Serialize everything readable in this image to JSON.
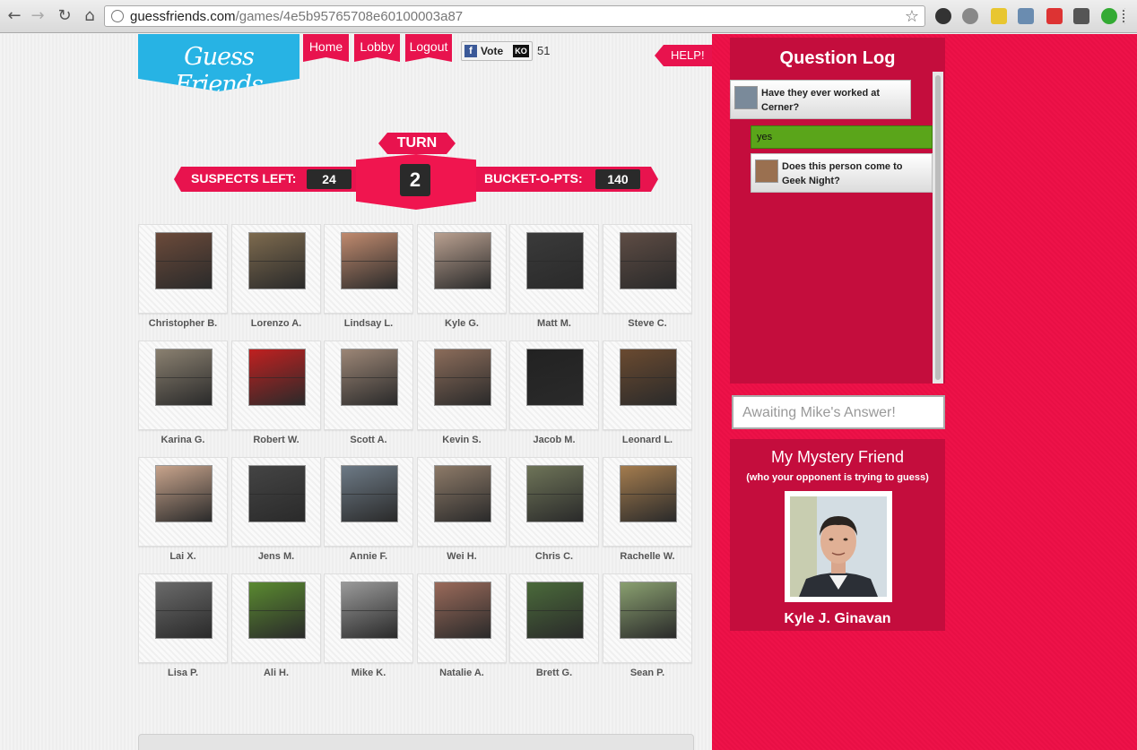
{
  "browser": {
    "url_domain": "guessfriends.com",
    "url_path": "/games/4e5b95765708e60100003a87",
    "back_icon": "back-arrow-icon",
    "forward_icon": "forward-arrow-icon",
    "reload_icon": "reload-icon",
    "home_icon": "home-icon",
    "bookmark_icon": "star-icon"
  },
  "header": {
    "logo_text": "Guess Friends",
    "nav": [
      {
        "label": "Home"
      },
      {
        "label": "Lobby"
      },
      {
        "label": "Logout"
      }
    ],
    "vote_label": "Vote",
    "vote_count": "51",
    "help_label": "HELP!"
  },
  "scoreboard": {
    "turn_label": "TURN",
    "turn_number": "2",
    "suspects_left_label": "SUSPECTS LEFT:",
    "suspects_left_value": "24",
    "bucket_label": "BUCKET-O-PTS:",
    "bucket_value": "140"
  },
  "suspects": [
    {
      "name": "Christopher B.",
      "color": "#6b4a3a"
    },
    {
      "name": "Lorenzo A.",
      "color": "#7d6a4e"
    },
    {
      "name": "Lindsay L.",
      "color": "#c08a6e"
    },
    {
      "name": "Kyle G.",
      "color": "#b9a090"
    },
    {
      "name": "Matt M.",
      "color": "#3a3a3a"
    },
    {
      "name": "Steve C.",
      "color": "#5e4c44"
    },
    {
      "name": "Karina G.",
      "color": "#8a8070"
    },
    {
      "name": "Robert W.",
      "color": "#c02020"
    },
    {
      "name": "Scott A.",
      "color": "#9c8676"
    },
    {
      "name": "Kevin S.",
      "color": "#8b6c5a"
    },
    {
      "name": "Jacob M.",
      "color": "#222222"
    },
    {
      "name": "Leonard L.",
      "color": "#6a4a30"
    },
    {
      "name": "Lai X.",
      "color": "#c8a48c"
    },
    {
      "name": "Jens M.",
      "color": "#444444"
    },
    {
      "name": "Annie F.",
      "color": "#6d7a86"
    },
    {
      "name": "Wei H.",
      "color": "#8d7a68"
    },
    {
      "name": "Chris C.",
      "color": "#6e7458"
    },
    {
      "name": "Rachelle W.",
      "color": "#a47c4e"
    },
    {
      "name": "Lisa P.",
      "color": "#6a6a6a"
    },
    {
      "name": "Ali H.",
      "color": "#5a8a30"
    },
    {
      "name": "Mike K.",
      "color": "#9a9a9a"
    },
    {
      "name": "Natalie A.",
      "color": "#9a6a5a"
    },
    {
      "name": "Brett G.",
      "color": "#4a6a3a"
    },
    {
      "name": "Sean P.",
      "color": "#8aa070"
    }
  ],
  "question_log": {
    "title": "Question Log",
    "entries": [
      {
        "type": "question",
        "text": "Have they ever worked at Cerner?"
      },
      {
        "type": "answer",
        "text": "yes"
      },
      {
        "type": "question",
        "text": "Does this person come to Geek Night?"
      }
    ]
  },
  "awaiting_text": "Awaiting Mike's Answer!",
  "mystery": {
    "title": "My Mystery Friend",
    "subtitle": "(who your opponent is trying to guess)",
    "name": "Kyle J. Ginavan"
  },
  "colors": {
    "accent": "#e8134e",
    "logo": "#27b3e4",
    "answer_green": "#5aa51a"
  }
}
